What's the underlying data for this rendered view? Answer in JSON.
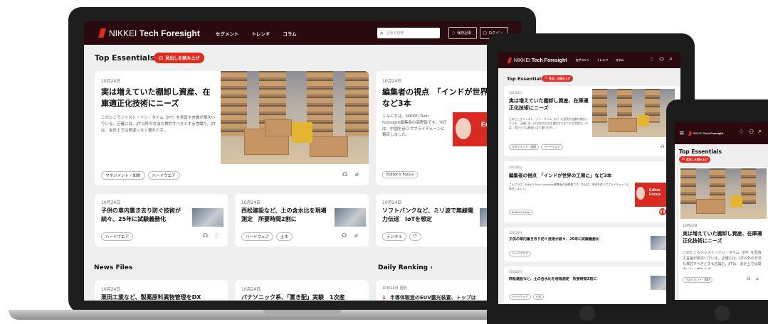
{
  "brand": {
    "prefix": "NIKKEI",
    "name": "Tech Foresight"
  },
  "nav": [
    "セグメント",
    "トレンド",
    "コラム"
  ],
  "search": {
    "placeholder": "記事を検索"
  },
  "header_buttons": {
    "saved": "保存記事",
    "login": "ログイン"
  },
  "top": {
    "heading": "Top Essentials",
    "listen": "見出しを読み上げ"
  },
  "articles": [
    {
      "date": "10月24日",
      "title": "実は増えていた棚卸し資産、在庫適正化技術にニーズ",
      "body": "このところジャスト・イン・タイム（JIT）を見直す言論が相次いでいる。正確には、JIT以外の方法も検討すべきとする言論だ。JITは、会計上では間違いなく優れた手…",
      "tags": [
        "マネジメント・知財",
        "ハードウエア"
      ]
    },
    {
      "date": "10月24日",
      "title": "編集者の視点　「インドが世界の工場に」など3本",
      "body": "こんにちは、NIKKEI Tech Foresight編集長の高野敦です。今日は、中国を追うサプライチェーンに着目しました。",
      "tags": [
        "Editor's Focus"
      ]
    },
    {
      "date": "10月24日",
      "title": "子供の車内置き去り防ぐ技術が続々、25年に試験義務化",
      "tags": [
        "ハードウエア"
      ]
    },
    {
      "date": "10月24日",
      "title": "西松建設など、土の含水比を現場測定　所要時間2割に",
      "tags": [
        "ハードウェア",
        "土木"
      ]
    },
    {
      "date": "10月24日",
      "title": "ソフトバンクなど、ミリ波で無線電力伝送　IoTを想定",
      "tags": [
        "デジタル",
        "IT"
      ]
    }
  ],
  "news_files": {
    "heading": "News Files",
    "items": [
      {
        "date": "10月24日",
        "title": "栗田工業など、製薬原料異物管理をDX"
      },
      {
        "date": "10月24日",
        "title": "パナソニック系、「置き配」実験　1次産"
      }
    ]
  },
  "ranking": {
    "heading": "Daily Ranking",
    "arrow": "›",
    "updated": "10月24日 更新",
    "first_rank": "1",
    "first_title": "半導体製造のEUV露光装置、トップは"
  },
  "focus_label": "Editor Focus",
  "icons": [
    "search-icon",
    "headphones-icon",
    "bookmark-icon",
    "user-icon",
    "menu-icon",
    "clip-icon",
    "pause-icon"
  ],
  "colors": {
    "accent": "#e32b1f",
    "header": "#2a0a0e",
    "background": "#efefef"
  }
}
